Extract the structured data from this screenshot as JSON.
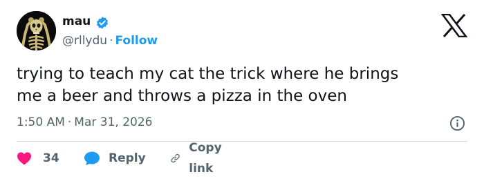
{
  "author": {
    "name": "mau",
    "handle": "@rllydu",
    "separator": "·",
    "follow_label": "Follow"
  },
  "tweet": {
    "text_line1": "trying to teach my cat the trick where he brings",
    "text_line2": "me a beer and throws a pizza in the oven",
    "time": "1:50 AM",
    "date_separator": "·",
    "date": "Mar 31, 2026"
  },
  "actions": {
    "like_count": "34",
    "reply_label": "Reply",
    "copy_label": "Copy link"
  },
  "colors": {
    "accent": "#1d9bf0",
    "like": "#f91880",
    "muted_text": "#536471",
    "main_text": "#0f1419",
    "divider": "#cfd9de"
  },
  "icons": {
    "verified": "verified-badge-icon",
    "brand": "x-logo-icon",
    "info": "info-icon",
    "like": "heart-icon",
    "reply": "speech-bubble-icon",
    "copy": "link-icon"
  }
}
